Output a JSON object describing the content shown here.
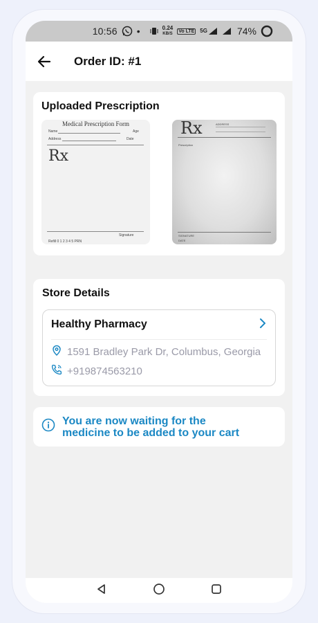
{
  "status_bar": {
    "time": "10:56",
    "whatsapp_icon": "whatsapp-icon",
    "dot": "•",
    "speed_value": "0.24",
    "speed_unit": "KB/S",
    "volte": "Vo LTE",
    "network": "5G",
    "battery": "74%"
  },
  "header": {
    "back_icon": "arrow-left-icon",
    "title": "Order ID: #1"
  },
  "prescription": {
    "section_title": "Uploaded Prescription",
    "images": [
      {
        "form_title": "Medical Prescription Form",
        "name": "Name",
        "age": "Age",
        "address": "Address",
        "date": "Date",
        "rx": "Rx",
        "signature": "Signature",
        "refill": "Refill  0  1  2  3  4  5  PRN"
      },
      {
        "rx": "Rx",
        "address": "ADDRESS",
        "prescription": "Prescription",
        "signature": "SIGNATURE",
        "date": "DATE"
      }
    ]
  },
  "store": {
    "section_title": "Store Details",
    "name": "Healthy Pharmacy",
    "chevron_icon": "chevron-right-icon",
    "address": "1591 Bradley Park Dr, Columbus, Georgia",
    "address_icon": "location-pin-icon",
    "phone": "+919874563210",
    "phone_icon": "phone-icon",
    "accent_color": "#1b88c4"
  },
  "info": {
    "icon": "info-icon",
    "line1": "You are now waiting for the",
    "line2": "medicine to be added to your cart"
  },
  "nav": {
    "back_icon": "nav-back-triangle-icon",
    "home_icon": "nav-home-circle-icon",
    "recents_icon": "nav-recents-square-icon"
  }
}
